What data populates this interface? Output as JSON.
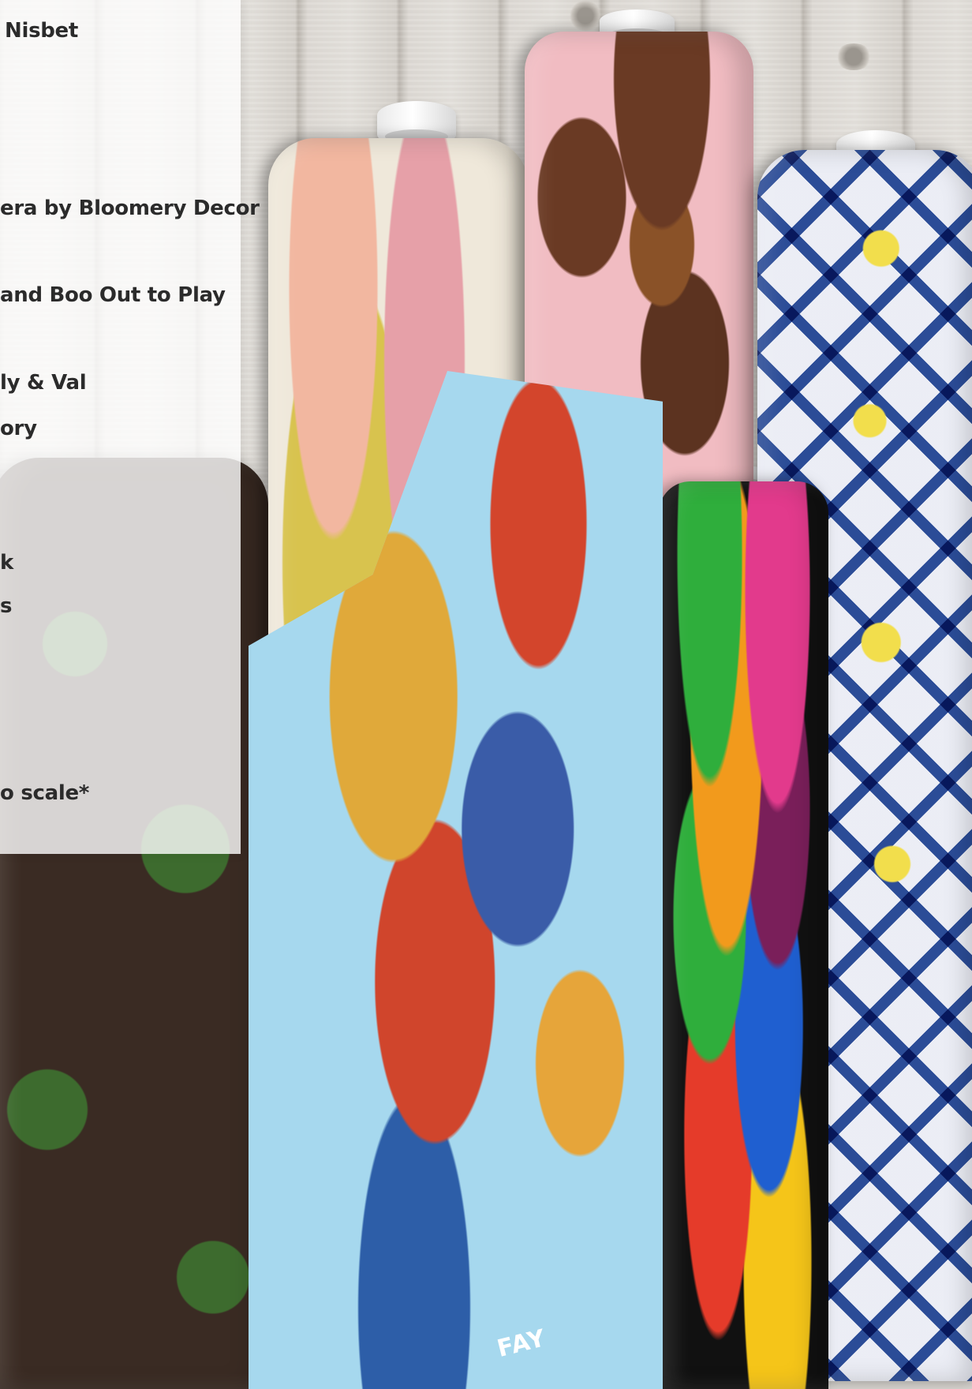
{
  "panel": {
    "lines": [
      "Nisbet",
      "era by Bloomery Decor",
      "and Boo Out to Play",
      "ly & Val",
      "ory",
      "k",
      "s",
      "o scale*"
    ]
  },
  "fabric_text": {
    "boat_label": "FAY"
  },
  "colors": {
    "panel_bg": "rgba(255,255,255,0.80)",
    "text": "#2b2b2b",
    "wood": "#dedad5",
    "sky_blue": "#a6d8ee",
    "tile_blue": "#2d4f9a",
    "candy_black": "#111111",
    "chocolate_pink": "#f1bcc2",
    "floral_cream": "#efe8da",
    "farm_brown": "#3a2b23"
  }
}
